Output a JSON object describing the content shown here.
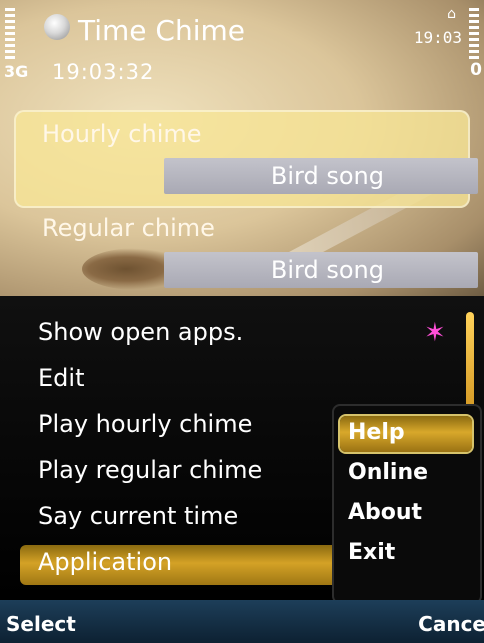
{
  "status_bar": {
    "app_title": "Time Chime",
    "clock_sub": "19:03:32",
    "clock_corner": "19:03",
    "network": "3G",
    "battery_level": "0"
  },
  "content": {
    "hourly_label": "Hourly chime",
    "hourly_value": "Bird song",
    "regular_label": "Regular chime",
    "regular_value": "Bird song"
  },
  "menu": {
    "items": [
      {
        "label": "Show open apps."
      },
      {
        "label": "Edit"
      },
      {
        "label": "Play hourly chime"
      },
      {
        "label": "Play regular chime"
      },
      {
        "label": "Say current time"
      },
      {
        "label": "Application"
      }
    ],
    "icon": "app-switcher-icon"
  },
  "submenu": {
    "items": [
      {
        "label": "Help"
      },
      {
        "label": "Online"
      },
      {
        "label": "About"
      },
      {
        "label": "Exit"
      }
    ]
  },
  "softkeys": {
    "left": "Select",
    "right": "Cance"
  },
  "colors": {
    "highlight": "#f7e696",
    "selection_gold": "#d4a226",
    "softkey_bar": "#1d3e59"
  }
}
